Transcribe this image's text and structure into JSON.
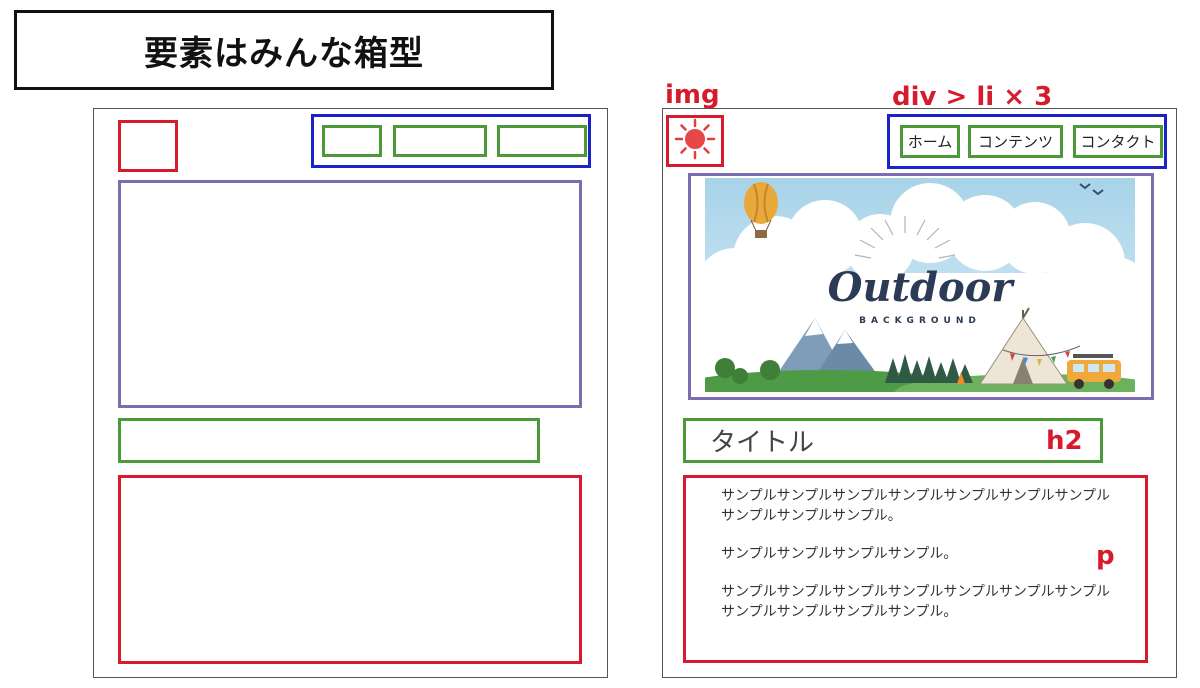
{
  "header": {
    "title": "要素はみんな箱型"
  },
  "annotations": {
    "img_logo": "img",
    "nav": "div > li × 3",
    "img_hero": "img",
    "heading": "h2",
    "paragraph": "p"
  },
  "nav": {
    "items": [
      "ホーム",
      "コンテンツ",
      "コンタクト"
    ]
  },
  "hero": {
    "word": "Outdoor",
    "sub": "BACKGROUND"
  },
  "content": {
    "title": "タイトル",
    "paragraphs": [
      "サンプルサンプルサンプルサンプルサンプルサンプルサンプルサンプルサンプルサンプル。",
      "サンプルサンプルサンプルサンプル。",
      "サンプルサンプルサンプルサンプルサンプルサンプルサンプルサンプルサンプルサンプルサンプル。"
    ]
  },
  "colors": {
    "img_border": "#d81b2c",
    "nav_border": "#1a23c9",
    "li_border": "#4a9a3a",
    "hero_border": "#7e6cb3",
    "annotation": "#d81b2c"
  },
  "icons": {
    "logo": "sun-icon"
  }
}
